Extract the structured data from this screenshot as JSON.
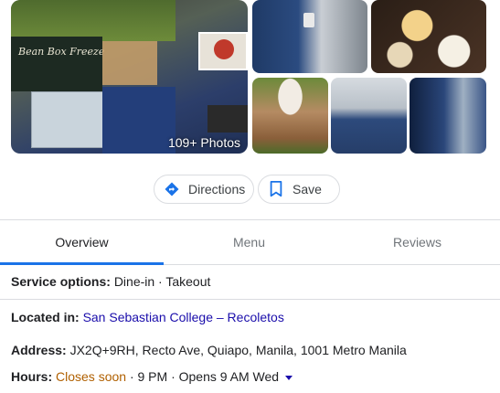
{
  "photos": {
    "count_label": "109+ Photos",
    "main_sign": "Bean Box Freeze"
  },
  "actions": {
    "directions_label": "Directions",
    "save_label": "Save"
  },
  "tabs": [
    {
      "label": "Overview",
      "active": true
    },
    {
      "label": "Menu",
      "active": false
    },
    {
      "label": "Reviews",
      "active": false
    }
  ],
  "info": {
    "service": {
      "label": "Service options:",
      "value": "Dine-in · Takeout"
    },
    "located": {
      "label": "Located in:",
      "value": "San Sebastian College – Recoletos"
    },
    "address": {
      "label": "Address:",
      "value": "JX2Q+9RH, Recto Ave, Quiapo, Manila, 1001 Metro Manila"
    },
    "hours": {
      "label": "Hours:",
      "status": "Closes soon",
      "detail": "· 9 PM · Opens 9 AM Wed"
    }
  },
  "colors": {
    "accent": "#1a73e8",
    "link": "#1a0dab",
    "closing": "#b06000"
  }
}
